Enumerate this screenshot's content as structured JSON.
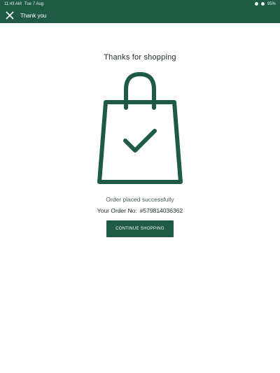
{
  "status_bar": {
    "time": "11:43 AM",
    "date": "Tue 7 Aug",
    "battery": "95%"
  },
  "app_bar": {
    "title": "Thank you",
    "close_icon": "close-icon"
  },
  "main": {
    "heading": "Thanks for shopping",
    "illustration_icon": "shopping-bag-check-icon",
    "success_message": "Order placed successfully",
    "order_label": "Your Order No:",
    "order_number": "#579814036362",
    "continue_button": "CONTINUE SHOPPING"
  },
  "colors": {
    "primary": "#1f5a45",
    "background": "#ffffff"
  }
}
